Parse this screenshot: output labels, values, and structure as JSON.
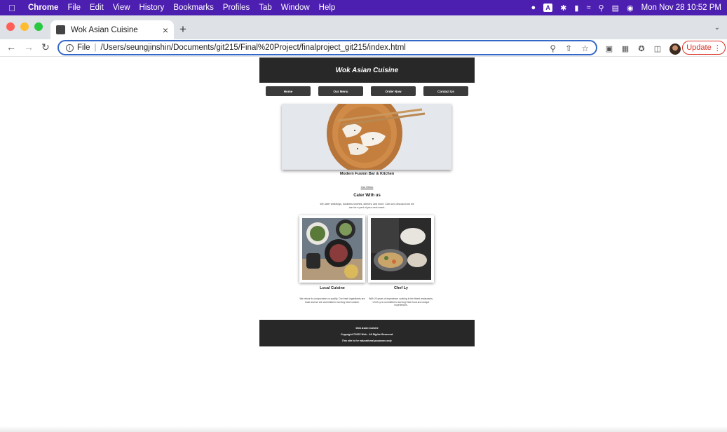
{
  "menubar": {
    "app_name": "Chrome",
    "menus": [
      "File",
      "Edit",
      "View",
      "History",
      "Bookmarks",
      "Profiles",
      "Tab",
      "Window",
      "Help"
    ],
    "clock": "Mon Nov 28  10:52 PM",
    "input_source": "A",
    "accent_color": "#4d1fb0"
  },
  "browser": {
    "tab_title": "Wok Asian Cuisine",
    "file_label": "File",
    "url": "/Users/seungjinshin/Documents/git215/Final%20Project/finalproject_git215/index.html",
    "update_label": "Update"
  },
  "site": {
    "title": "Wok Asian Cuisine",
    "nav": [
      "Home",
      "Our Menu",
      "Order Now",
      "Contact Us"
    ],
    "tagline": "Modern Fusion Bar & Kitchen",
    "menu_link": "Our Menu",
    "cater_title": "Cater With us",
    "cater_desc": "We cater weddings, business lunches, dinners, and more. Call us to discuss how we can be a part of your next event.",
    "features": [
      {
        "title": "Local Cuisine",
        "desc": "We refuse to compromise on quality. Our fresh ingredients are local and we are committed to serving fresh cuisine."
      },
      {
        "title": "Chef Ly",
        "desc": "With 20 years of experience cooking in the finest restaurants, Chef Ly is committed to serving fresh food and unique experiences."
      }
    ],
    "footer": {
      "line1": "Wok Asian Cuisine",
      "line2": "Copyright ©2022 Wok - All Rights Reserved.",
      "line3": "This site is for educational purposes only."
    }
  }
}
